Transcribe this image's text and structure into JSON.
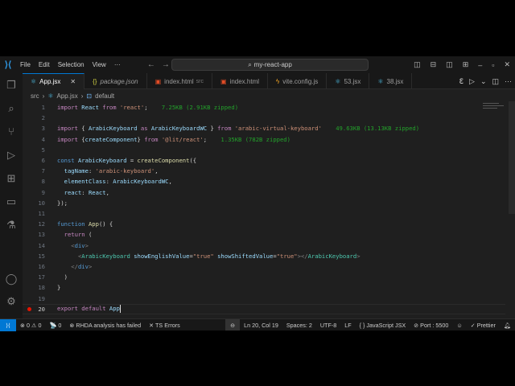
{
  "titlebar": {
    "menus": [
      "File",
      "Edit",
      "Selection",
      "View",
      "···"
    ],
    "search": "my-react-app"
  },
  "tabs": [
    {
      "label": "App.jsx",
      "icon": "react-icon",
      "active": true,
      "close": "✕"
    },
    {
      "label": "package.json",
      "icon": "json-icon"
    },
    {
      "label": "index.html",
      "sub": "src",
      "icon": "html-icon"
    },
    {
      "label": "index.html",
      "icon": "html-icon"
    },
    {
      "label": "vite.config.js",
      "icon": "vite-icon"
    },
    {
      "label": "53.jsx",
      "icon": "react-icon"
    },
    {
      "label": "38.jsx",
      "icon": "react-icon"
    }
  ],
  "breadcrumb": {
    "folder": "src",
    "file": "App.jsx",
    "symbol": "default"
  },
  "editor": {
    "lines": [
      {
        "n": "1",
        "seg": [
          [
            "import ",
            "kw"
          ],
          [
            "React ",
            "v"
          ],
          [
            "from ",
            "kw"
          ],
          [
            "'react'",
            "s"
          ],
          [
            ";",
            "p"
          ],
          [
            "    7.25KB (2.91KB zipped)",
            "c"
          ]
        ]
      },
      {
        "n": "2",
        "seg": []
      },
      {
        "n": "3",
        "seg": [
          [
            "import ",
            "kw"
          ],
          [
            "{ ",
            "p"
          ],
          [
            "ArabicKeyboard ",
            "v"
          ],
          [
            "as ",
            "kw"
          ],
          [
            "ArabicKeyboardWC ",
            "v"
          ],
          [
            "} ",
            "p"
          ],
          [
            "from ",
            "kw"
          ],
          [
            "'arabic-virtual-keyboard'",
            "s"
          ],
          [
            "    49.63KB (13.13KB zipped)",
            "c"
          ]
        ]
      },
      {
        "n": "4",
        "seg": [
          [
            "import ",
            "kw"
          ],
          [
            "{",
            "p"
          ],
          [
            "createComponent",
            "v"
          ],
          [
            "} ",
            "p"
          ],
          [
            "from ",
            "kw"
          ],
          [
            "'@lit/react'",
            "s"
          ],
          [
            ";",
            "p"
          ],
          [
            "    1.35KB (782B zipped)",
            "c"
          ]
        ]
      },
      {
        "n": "5",
        "seg": []
      },
      {
        "n": "6",
        "seg": [
          [
            "const ",
            "k"
          ],
          [
            "ArabicKeyboard ",
            "v"
          ],
          [
            "= ",
            "p"
          ],
          [
            "createComponent",
            "f"
          ],
          [
            "({",
            "p"
          ]
        ]
      },
      {
        "n": "7",
        "seg": [
          [
            "  tagName",
            "v"
          ],
          [
            ": ",
            "p"
          ],
          [
            "'arabic-keyboard'",
            "s"
          ],
          [
            ",",
            "p"
          ]
        ]
      },
      {
        "n": "8",
        "seg": [
          [
            "  elementClass",
            "v"
          ],
          [
            ": ",
            "p"
          ],
          [
            "ArabicKeyboardWC",
            "v"
          ],
          [
            ",",
            "p"
          ]
        ]
      },
      {
        "n": "9",
        "seg": [
          [
            "  react",
            "v"
          ],
          [
            ": ",
            "p"
          ],
          [
            "React",
            "v"
          ],
          [
            ",",
            "p"
          ]
        ]
      },
      {
        "n": "10",
        "seg": [
          [
            "});",
            "p"
          ]
        ]
      },
      {
        "n": "11",
        "seg": []
      },
      {
        "n": "12",
        "seg": [
          [
            "function ",
            "k"
          ],
          [
            "App",
            "f"
          ],
          [
            "() {",
            "p"
          ]
        ]
      },
      {
        "n": "13",
        "seg": [
          [
            "  return ",
            "kw"
          ],
          [
            "(",
            "p"
          ]
        ]
      },
      {
        "n": "14",
        "seg": [
          [
            "    <",
            "g"
          ],
          [
            "div",
            "k"
          ],
          [
            ">",
            "g"
          ]
        ]
      },
      {
        "n": "15",
        "seg": [
          [
            "      <",
            "g"
          ],
          [
            "ArabicKeyboard ",
            "t"
          ],
          [
            "showEnglishValue",
            "v"
          ],
          [
            "=",
            "p"
          ],
          [
            "\"true\" ",
            "s"
          ],
          [
            "showShiftedValue",
            "v"
          ],
          [
            "=",
            "p"
          ],
          [
            "\"true\"",
            "s"
          ],
          [
            "></",
            "g"
          ],
          [
            "ArabicKeyboard",
            "t"
          ],
          [
            ">",
            "g"
          ]
        ]
      },
      {
        "n": "16",
        "seg": [
          [
            "    </",
            "g"
          ],
          [
            "div",
            "k"
          ],
          [
            ">",
            "g"
          ]
        ]
      },
      {
        "n": "17",
        "seg": [
          [
            "  )",
            "p"
          ]
        ]
      },
      {
        "n": "18",
        "seg": [
          [
            "}",
            "p"
          ]
        ]
      },
      {
        "n": "19",
        "seg": []
      },
      {
        "n": "20",
        "seg": [
          [
            "export ",
            "kw"
          ],
          [
            "default ",
            "kw"
          ],
          [
            "App",
            "v"
          ]
        ],
        "current": true,
        "breakpoint": true
      }
    ]
  },
  "status": {
    "problems": "⊗ 0 ⚠ 0",
    "ports": "📡 0",
    "rhda": "⊗ RHDA analysis has failed",
    "ts": "✕ TS Errors",
    "position": "Ln 20, Col 19",
    "spaces": "Spaces: 2",
    "encoding": "UTF-8",
    "eol": "LF",
    "language": "{ } JavaScript JSX",
    "port": "⊘ Port : 5500",
    "prettier": "✓ Prettier"
  },
  "colors": {
    "accent": "#0078d4",
    "background": "#1f1f1f"
  }
}
